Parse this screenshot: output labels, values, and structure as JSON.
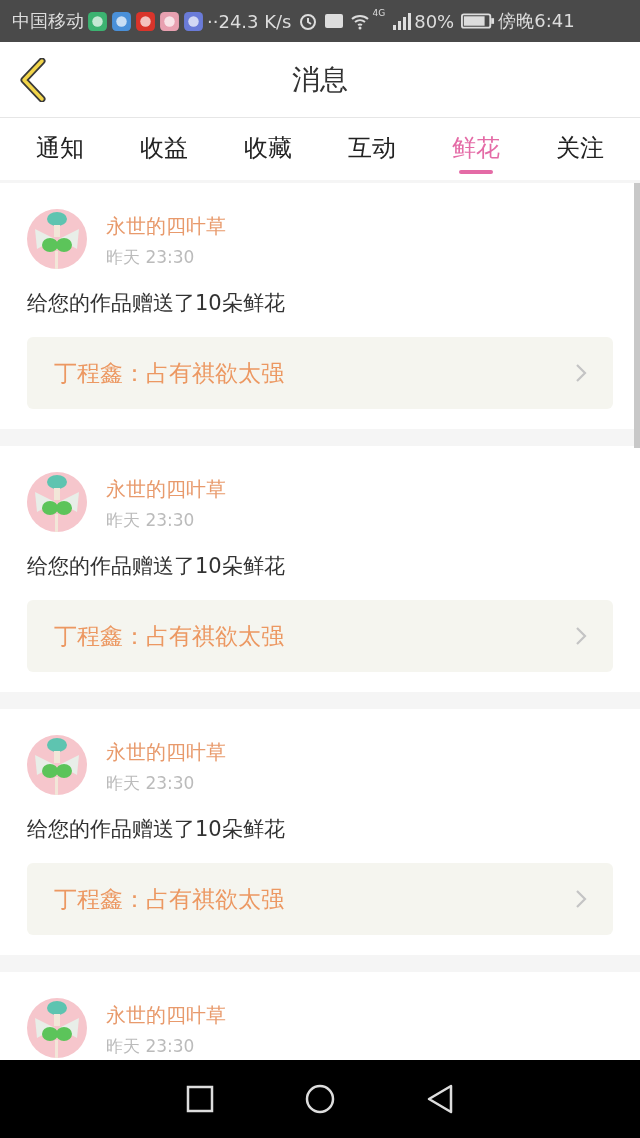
{
  "status_bar": {
    "carrier": "中国移动",
    "speed": "··24.3 K/s",
    "network": "4G",
    "battery": "80%",
    "time": "傍晚6:41"
  },
  "header": {
    "title": "消息"
  },
  "tabs": [
    {
      "label": "通知",
      "selected": false
    },
    {
      "label": "收益",
      "selected": false
    },
    {
      "label": "收藏",
      "selected": false
    },
    {
      "label": "互动",
      "selected": false
    },
    {
      "label": "鲜花",
      "selected": true
    },
    {
      "label": "关注",
      "selected": false
    }
  ],
  "messages": [
    {
      "user": "永世的四叶草",
      "time": "昨天 23:30",
      "text": "给您的作品赠送了10朵鲜花",
      "work": "丁程鑫：占有祺欲太强"
    },
    {
      "user": "永世的四叶草",
      "time": "昨天 23:30",
      "text": "给您的作品赠送了10朵鲜花",
      "work": "丁程鑫：占有祺欲太强"
    },
    {
      "user": "永世的四叶草",
      "time": "昨天 23:30",
      "text": "给您的作品赠送了10朵鲜花",
      "work": "丁程鑫：占有祺欲太强"
    },
    {
      "user": "永世的四叶草",
      "time": "昨天 23:30"
    }
  ]
}
